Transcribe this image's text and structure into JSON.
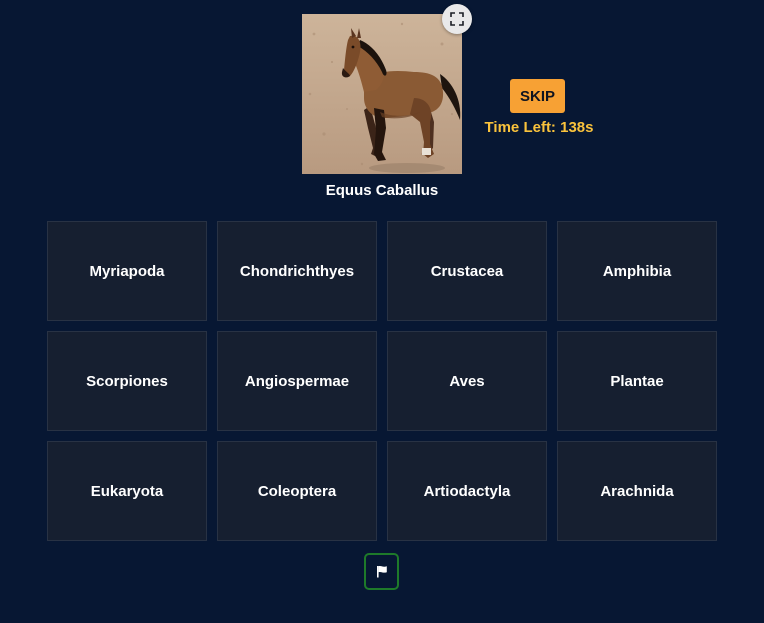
{
  "question": {
    "species_name": "Equus Caballus",
    "image_subject": "horse-photo"
  },
  "controls": {
    "skip_label": "SKIP",
    "timer_text": "Time Left: 138s"
  },
  "options": [
    "Myriapoda",
    "Chondrichthyes",
    "Crustacea",
    "Amphibia",
    "Scorpiones",
    "Angiospermae",
    "Aves",
    "Plantae",
    "Eukaryota",
    "Coleoptera",
    "Artiodactyla",
    "Arachnida"
  ],
  "icons": {
    "expand": "expand-icon",
    "flag": "flag-icon"
  },
  "colors": {
    "background": "#071733",
    "skip_button": "#f7a134",
    "timer_text": "#f9c23c",
    "tile_background": "#161f30",
    "flag_border": "#1e7a2a"
  }
}
